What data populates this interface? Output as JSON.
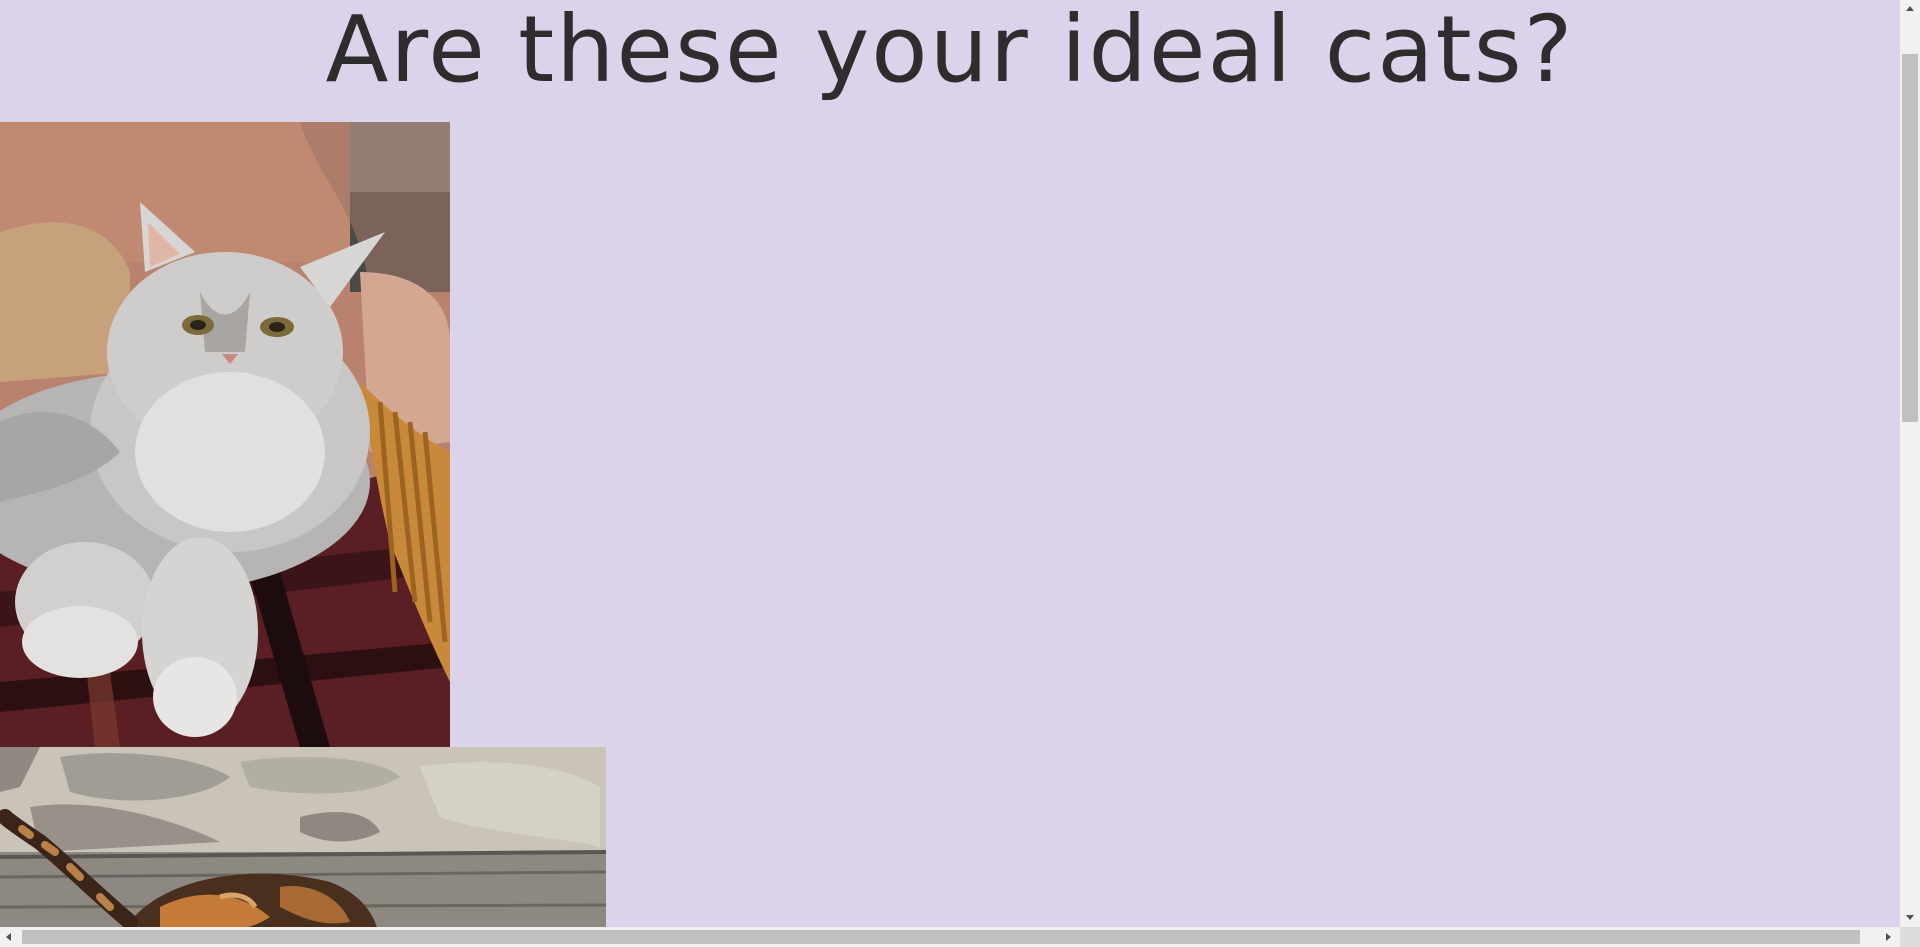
{
  "page": {
    "title": "Are these your ideal cats?",
    "background_color": "#dbd3ea",
    "text_color": "#2f2c2e"
  },
  "images": [
    {
      "name": "persian-cat-photo",
      "alt": "Grey Persian cat lying on a patterned blanket"
    },
    {
      "name": "tortoiseshell-cat-photo",
      "alt": "Tortoiseshell cat walking on a wooden log by a stone wall"
    }
  ],
  "scrollbars": {
    "vertical_icon_up": "chevron-up-icon",
    "vertical_icon_down": "chevron-down-icon",
    "horizontal_icon_left": "chevron-left-icon",
    "horizontal_icon_right": "chevron-right-icon"
  }
}
